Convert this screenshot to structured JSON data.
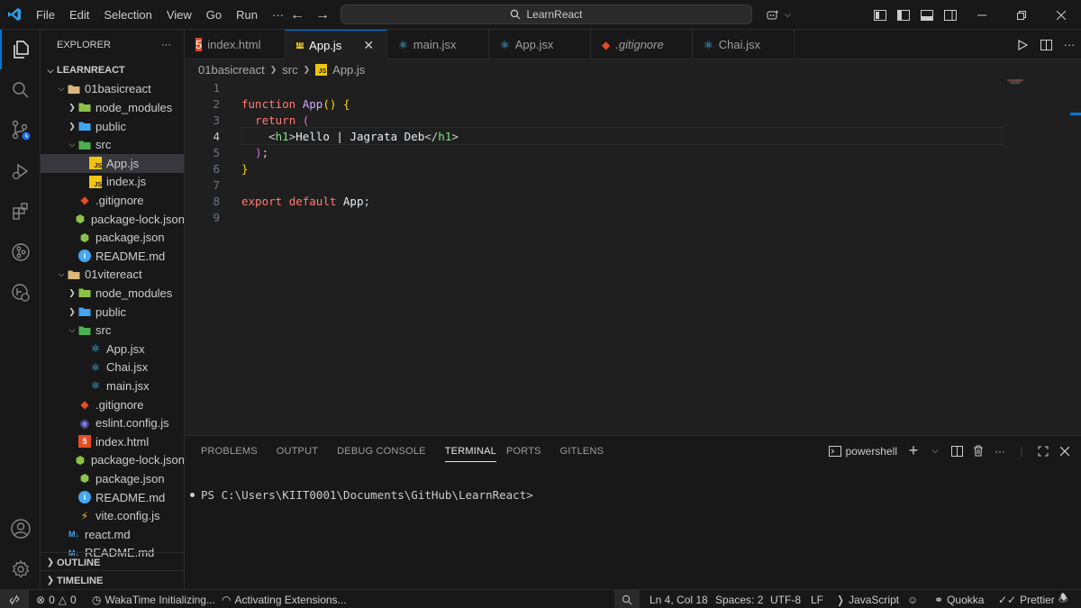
{
  "menu": [
    "File",
    "Edit",
    "Selection",
    "View",
    "Go",
    "Run",
    "···"
  ],
  "search": {
    "text": "LearnReact"
  },
  "sidebar": {
    "title": "EXPLORER",
    "more": "···",
    "tree": [
      {
        "label": "LEARNREACT",
        "indent": 0,
        "chevron": "down",
        "icon": "none",
        "bold": true
      },
      {
        "label": "01basicreact",
        "indent": 1,
        "chevron": "down",
        "icon": "folder"
      },
      {
        "label": "node_modules",
        "indent": 2,
        "chevron": "right",
        "icon": "folder-node"
      },
      {
        "label": "public",
        "indent": 2,
        "chevron": "right",
        "icon": "folder-public"
      },
      {
        "label": "src",
        "indent": 2,
        "chevron": "down",
        "icon": "folder-src"
      },
      {
        "label": "App.js",
        "indent": 3,
        "chevron": "none",
        "icon": "js",
        "selected": true
      },
      {
        "label": "index.js",
        "indent": 3,
        "chevron": "none",
        "icon": "js"
      },
      {
        "label": ".gitignore",
        "indent": 2,
        "chevron": "none",
        "icon": "git"
      },
      {
        "label": "package-lock.json",
        "indent": 2,
        "chevron": "none",
        "icon": "npm"
      },
      {
        "label": "package.json",
        "indent": 2,
        "chevron": "none",
        "icon": "npm"
      },
      {
        "label": "README.md",
        "indent": 2,
        "chevron": "none",
        "icon": "info"
      },
      {
        "label": "01vitereact",
        "indent": 1,
        "chevron": "down",
        "icon": "folder"
      },
      {
        "label": "node_modules",
        "indent": 2,
        "chevron": "right",
        "icon": "folder-node"
      },
      {
        "label": "public",
        "indent": 2,
        "chevron": "right",
        "icon": "folder-public"
      },
      {
        "label": "src",
        "indent": 2,
        "chevron": "down",
        "icon": "folder-src"
      },
      {
        "label": "App.jsx",
        "indent": 3,
        "chevron": "none",
        "icon": "react"
      },
      {
        "label": "Chai.jsx",
        "indent": 3,
        "chevron": "none",
        "icon": "react"
      },
      {
        "label": "main.jsx",
        "indent": 3,
        "chevron": "none",
        "icon": "react"
      },
      {
        "label": ".gitignore",
        "indent": 2,
        "chevron": "none",
        "icon": "git"
      },
      {
        "label": "eslint.config.js",
        "indent": 2,
        "chevron": "none",
        "icon": "eslint"
      },
      {
        "label": "index.html",
        "indent": 2,
        "chevron": "none",
        "icon": "html"
      },
      {
        "label": "package-lock.json",
        "indent": 2,
        "chevron": "none",
        "icon": "npm"
      },
      {
        "label": "package.json",
        "indent": 2,
        "chevron": "none",
        "icon": "npm"
      },
      {
        "label": "README.md",
        "indent": 2,
        "chevron": "none",
        "icon": "info"
      },
      {
        "label": "vite.config.js",
        "indent": 2,
        "chevron": "none",
        "icon": "vite"
      },
      {
        "label": "react.md",
        "indent": 1,
        "chevron": "none",
        "icon": "md"
      },
      {
        "label": "README.md",
        "indent": 1,
        "chevron": "none",
        "icon": "md"
      }
    ],
    "outline": "OUTLINE",
    "timeline": "TIMELINE"
  },
  "tabs": [
    {
      "label": "index.html",
      "icon": "html",
      "active": false,
      "italic": false
    },
    {
      "label": "App.js",
      "icon": "js",
      "active": true,
      "italic": false,
      "close": "✕"
    },
    {
      "label": "main.jsx",
      "icon": "react",
      "active": false,
      "italic": false
    },
    {
      "label": "App.jsx",
      "icon": "react",
      "active": false,
      "italic": false
    },
    {
      "label": ".gitignore",
      "icon": "git",
      "active": false,
      "italic": true
    },
    {
      "label": "Chai.jsx",
      "icon": "react",
      "active": false,
      "italic": false
    }
  ],
  "breadcrumb": [
    "01basicreact",
    "src",
    "App.js"
  ],
  "editor": {
    "current_line": 4,
    "lines": [
      {
        "n": "1",
        "tokens": []
      },
      {
        "n": "2",
        "tokens": [
          [
            "kw",
            "function "
          ],
          [
            "fn",
            "App"
          ],
          [
            "brk1",
            "()"
          ],
          [
            "punc",
            " "
          ],
          [
            "brk1",
            "{"
          ]
        ]
      },
      {
        "n": "3",
        "tokens": [
          [
            "punc",
            "  "
          ],
          [
            "kw",
            "return "
          ],
          [
            "brk2",
            "("
          ]
        ]
      },
      {
        "n": "4",
        "tokens": [
          [
            "punc",
            "    "
          ],
          [
            "punc",
            "<"
          ],
          [
            "tag",
            "h1"
          ],
          [
            "punc",
            ">"
          ],
          [
            "txt",
            "Hello | Jagrata Deb"
          ],
          [
            "punc",
            "</"
          ],
          [
            "tag",
            "h1"
          ],
          [
            "punc",
            ">"
          ]
        ]
      },
      {
        "n": "5",
        "tokens": [
          [
            "punc",
            "  "
          ],
          [
            "brk2",
            ")"
          ],
          [
            "punc",
            ";"
          ]
        ]
      },
      {
        "n": "6",
        "tokens": [
          [
            "brk1",
            "}"
          ]
        ]
      },
      {
        "n": "7",
        "tokens": []
      },
      {
        "n": "8",
        "tokens": [
          [
            "kw",
            "export "
          ],
          [
            "kw",
            "default "
          ],
          [
            "txt",
            "App"
          ],
          [
            "punc",
            ";"
          ]
        ]
      },
      {
        "n": "9",
        "tokens": []
      }
    ]
  },
  "panel": {
    "tabs": [
      "PROBLEMS",
      "OUTPUT",
      "DEBUG CONSOLE",
      "TERMINAL",
      "PORTS",
      "GITLENS"
    ],
    "active_tab": "TERMINAL",
    "shell": "powershell",
    "terminal_prompt": "PS C:\\Users\\KIIT0001\\Documents\\GitHub\\LearnReact>"
  },
  "status": {
    "errors": "0",
    "warnings": "0",
    "wakatime": "WakaTime Initializing...",
    "activating": "Activating Extensions...",
    "position": "Ln 4, Col 18",
    "spaces": "Spaces: 2",
    "encoding": "UTF-8",
    "eol": "LF",
    "language": "JavaScript",
    "quokka": "Quokka",
    "prettier": "Prettier"
  },
  "colors": {
    "accent": "#0078d4",
    "keyword": "#ff7b72",
    "function": "#d2a8ff",
    "tag": "#7ee787",
    "js_icon": "#f1c40f",
    "react_icon": "#4fc3f7",
    "html_icon": "#e44d26",
    "npm_icon": "#8bc34a"
  }
}
